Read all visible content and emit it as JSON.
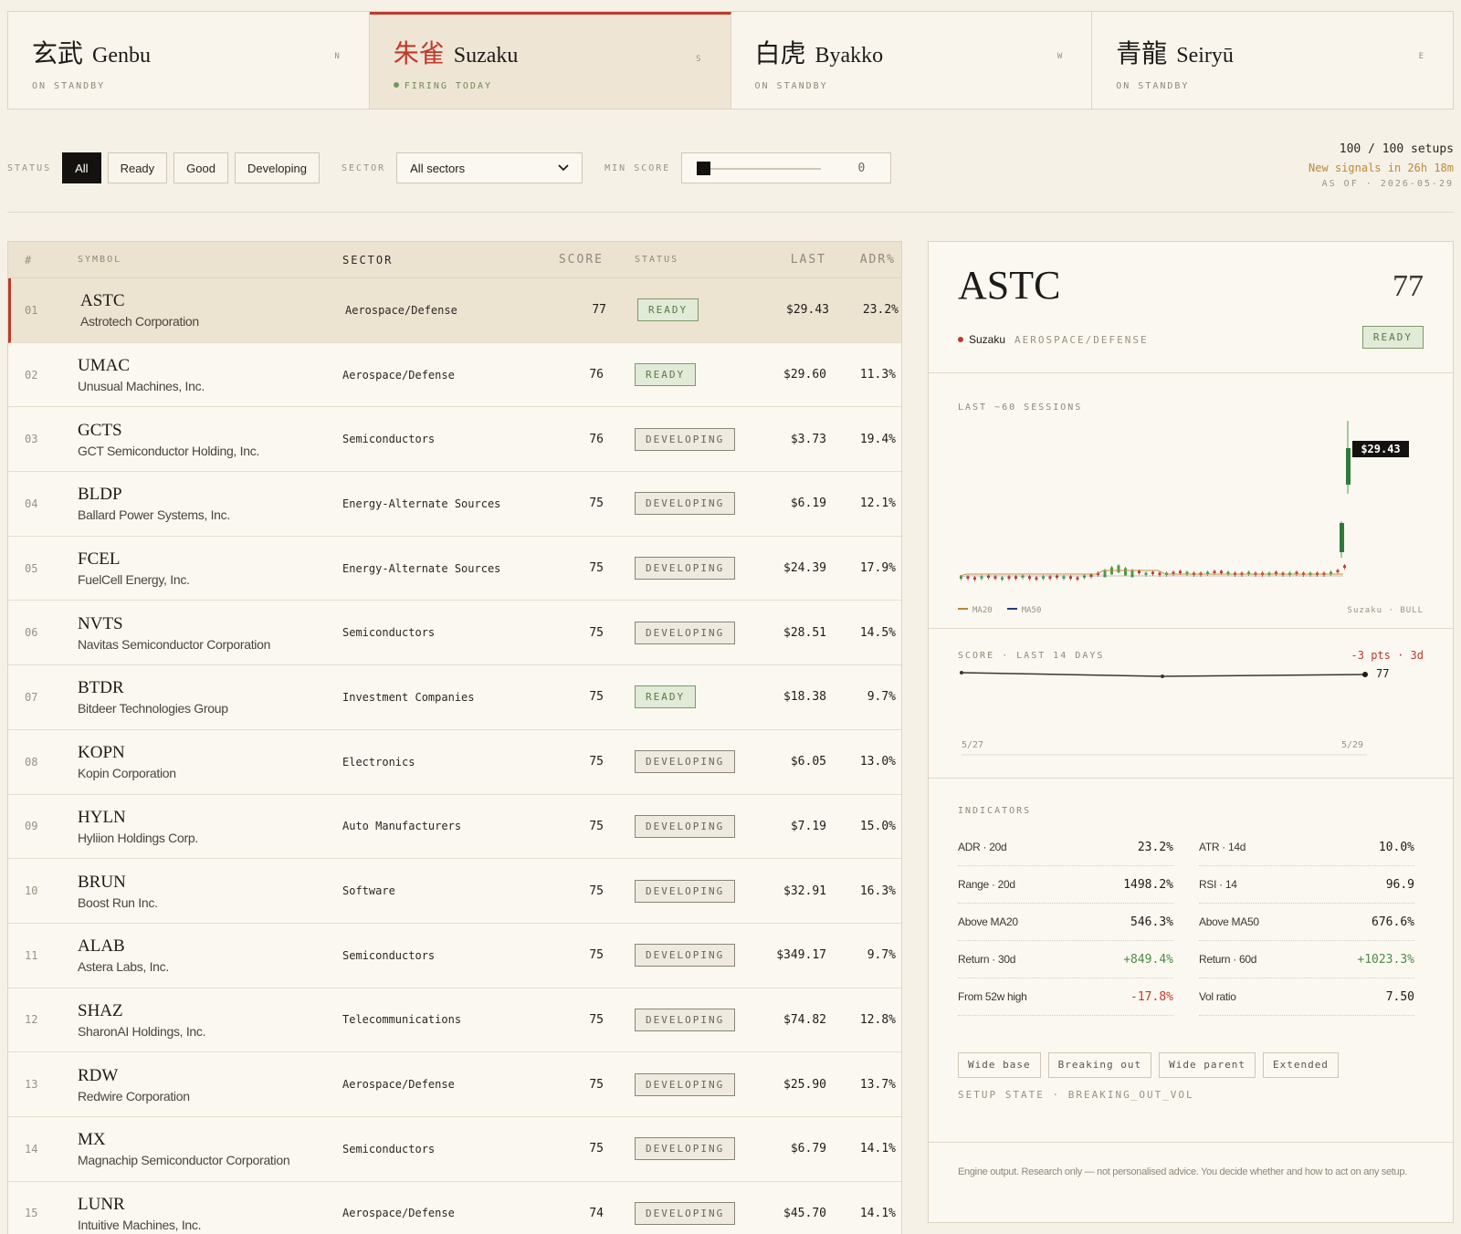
{
  "engines": [
    {
      "kanji": "玄武",
      "name": "Genbu",
      "dir": "N",
      "state": "ON STANDBY",
      "active": false
    },
    {
      "kanji": "朱雀",
      "name": "Suzaku",
      "dir": "S",
      "state": "FIRING TODAY",
      "active": true
    },
    {
      "kanji": "白虎",
      "name": "Byakko",
      "dir": "W",
      "state": "ON STANDBY",
      "active": false
    },
    {
      "kanji": "青龍",
      "name": "Seiryū",
      "dir": "E",
      "state": "ON STANDBY",
      "active": false
    }
  ],
  "filters": {
    "status_label": "STATUS",
    "status_options": [
      "All",
      "Ready",
      "Good",
      "Developing"
    ],
    "status_selected": "All",
    "sector_label": "SECTOR",
    "sector_value": "All sectors",
    "min_score_label": "MIN SCORE",
    "min_score_value": "0"
  },
  "summary": {
    "count": "100 / 100 setups",
    "next": "New signals in 26h 18m",
    "asof": "AS OF · 2026-05-29"
  },
  "table": {
    "headers": {
      "num": "#",
      "symbol": "SYMBOL",
      "sector": "SECTOR",
      "score": "SCORE",
      "status": "STATUS",
      "last": "LAST",
      "adr": "ADR%"
    },
    "rows": [
      {
        "num": "01",
        "ticker": "ASTC",
        "name": "Astrotech Corporation",
        "sector": "Aerospace/Defense",
        "score": "77",
        "status": "READY",
        "last": "$29.43",
        "adr": "23.2%"
      },
      {
        "num": "02",
        "ticker": "UMAC",
        "name": "Unusual Machines, Inc.",
        "sector": "Aerospace/Defense",
        "score": "76",
        "status": "READY",
        "last": "$29.60",
        "adr": "11.3%"
      },
      {
        "num": "03",
        "ticker": "GCTS",
        "name": "GCT Semiconductor Holding, Inc.",
        "sector": "Semiconductors",
        "score": "76",
        "status": "DEVELOPING",
        "last": "$3.73",
        "adr": "19.4%"
      },
      {
        "num": "04",
        "ticker": "BLDP",
        "name": "Ballard Power Systems, Inc.",
        "sector": "Energy-Alternate Sources",
        "score": "75",
        "status": "DEVELOPING",
        "last": "$6.19",
        "adr": "12.1%"
      },
      {
        "num": "05",
        "ticker": "FCEL",
        "name": "FuelCell Energy, Inc.",
        "sector": "Energy-Alternate Sources",
        "score": "75",
        "status": "DEVELOPING",
        "last": "$24.39",
        "adr": "17.9%"
      },
      {
        "num": "06",
        "ticker": "NVTS",
        "name": "Navitas Semiconductor Corporation",
        "sector": "Semiconductors",
        "score": "75",
        "status": "DEVELOPING",
        "last": "$28.51",
        "adr": "14.5%"
      },
      {
        "num": "07",
        "ticker": "BTDR",
        "name": "Bitdeer Technologies Group",
        "sector": "Investment Companies",
        "score": "75",
        "status": "READY",
        "last": "$18.38",
        "adr": "9.7%"
      },
      {
        "num": "08",
        "ticker": "KOPN",
        "name": "Kopin Corporation",
        "sector": "Electronics",
        "score": "75",
        "status": "DEVELOPING",
        "last": "$6.05",
        "adr": "13.0%"
      },
      {
        "num": "09",
        "ticker": "HYLN",
        "name": "Hyliion Holdings Corp.",
        "sector": "Auto Manufacturers",
        "score": "75",
        "status": "DEVELOPING",
        "last": "$7.19",
        "adr": "15.0%"
      },
      {
        "num": "10",
        "ticker": "BRUN",
        "name": "Boost Run Inc.",
        "sector": "Software",
        "score": "75",
        "status": "DEVELOPING",
        "last": "$32.91",
        "adr": "16.3%"
      },
      {
        "num": "11",
        "ticker": "ALAB",
        "name": "Astera Labs, Inc.",
        "sector": "Semiconductors",
        "score": "75",
        "status": "DEVELOPING",
        "last": "$349.17",
        "adr": "9.7%"
      },
      {
        "num": "12",
        "ticker": "SHAZ",
        "name": "SharonAI Holdings, Inc.",
        "sector": "Telecommunications",
        "score": "75",
        "status": "DEVELOPING",
        "last": "$74.82",
        "adr": "12.8%"
      },
      {
        "num": "13",
        "ticker": "RDW",
        "name": "Redwire Corporation",
        "sector": "Aerospace/Defense",
        "score": "75",
        "status": "DEVELOPING",
        "last": "$25.90",
        "adr": "13.7%"
      },
      {
        "num": "14",
        "ticker": "MX",
        "name": "Magnachip Semiconductor Corporation",
        "sector": "Semiconductors",
        "score": "75",
        "status": "DEVELOPING",
        "last": "$6.79",
        "adr": "14.1%"
      },
      {
        "num": "15",
        "ticker": "LUNR",
        "name": "Intuitive Machines, Inc.",
        "sector": "Aerospace/Defense",
        "score": "74",
        "status": "DEVELOPING",
        "last": "$45.70",
        "adr": "14.1%"
      }
    ]
  },
  "detail": {
    "ticker": "ASTC",
    "score": "77",
    "engine": "Suzaku",
    "sector": "AEROSPACE/DEFENSE",
    "status": "READY",
    "price_label": "LAST ~60 SESSIONS",
    "price_tag": "$29.43",
    "legend_ma20": "MA20",
    "legend_ma50": "MA50",
    "chart_note": "Suzaku · BULL",
    "score_label": "SCORE · LAST 14 DAYS",
    "score_delta": "-3 pts · 3d",
    "score_end": "77",
    "score_x_start": "5/27",
    "score_x_end": "5/29",
    "indicators_label": "INDICATORS",
    "indicators": [
      {
        "k": "ADR · 20d",
        "v": "23.2%",
        "tone": ""
      },
      {
        "k": "ATR · 14d",
        "v": "10.0%",
        "tone": ""
      },
      {
        "k": "Range · 20d",
        "v": "1498.2%",
        "tone": ""
      },
      {
        "k": "RSI · 14",
        "v": "96.9",
        "tone": ""
      },
      {
        "k": "Above MA20",
        "v": "546.3%",
        "tone": ""
      },
      {
        "k": "Above MA50",
        "v": "676.6%",
        "tone": ""
      },
      {
        "k": "Return · 30d",
        "v": "+849.4%",
        "tone": "pos"
      },
      {
        "k": "Return · 60d",
        "v": "+1023.3%",
        "tone": "pos"
      },
      {
        "k": "From 52w high",
        "v": "-17.8%",
        "tone": "neg"
      },
      {
        "k": "Vol ratio",
        "v": "7.50",
        "tone": ""
      }
    ],
    "tags": [
      "Wide base",
      "Breaking out",
      "Wide parent",
      "Extended"
    ],
    "setup_state": "SETUP STATE · BREAKING_OUT_VOL",
    "disclaimer": "Engine output. Research only — not personalised advice. You decide whether and how to act on any setup."
  },
  "colors": {
    "accent": "#c0392b",
    "ready": "#5a7a48",
    "ma20": "#b8863a",
    "ma50": "#2a3a7a"
  }
}
